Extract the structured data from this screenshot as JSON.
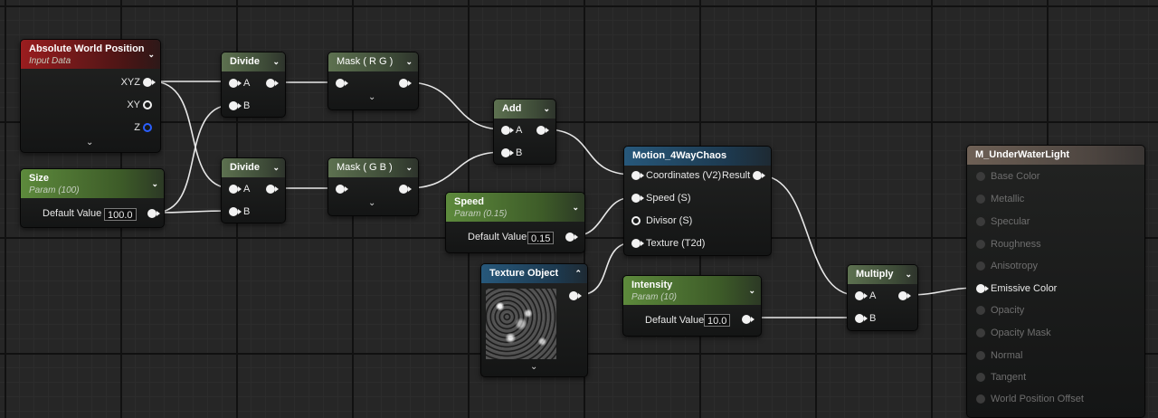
{
  "nodes": {
    "absolute_world_position": {
      "title": "Absolute World Position",
      "subtitle": "Input Data",
      "outputs": [
        "XYZ",
        "XY",
        "Z"
      ]
    },
    "size": {
      "title": "Size",
      "subtitle": "Param (100)",
      "default_label": "Default Value",
      "default_value": "100.0"
    },
    "divide_1": {
      "title": "Divide",
      "inputs": [
        "A",
        "B"
      ]
    },
    "divide_2": {
      "title": "Divide",
      "inputs": [
        "A",
        "B"
      ]
    },
    "mask_rg": {
      "title": "Mask ( R G )"
    },
    "mask_gb": {
      "title": "Mask ( G B )"
    },
    "add": {
      "title": "Add",
      "inputs": [
        "A",
        "B"
      ]
    },
    "speed": {
      "title": "Speed",
      "subtitle": "Param (0.15)",
      "default_label": "Default Value",
      "default_value": "0.15"
    },
    "texture_object": {
      "title": "Texture Object"
    },
    "motion_4waychaos": {
      "title": "Motion_4WayChaos",
      "inputs": [
        "Coordinates (V2)",
        "Speed (S)",
        "Divisor (S)",
        "Texture (T2d)"
      ],
      "output": "Result"
    },
    "intensity": {
      "title": "Intensity",
      "subtitle": "Param (10)",
      "default_label": "Default Value",
      "default_value": "10.0"
    },
    "multiply": {
      "title": "Multiply",
      "inputs": [
        "A",
        "B"
      ]
    },
    "material_result": {
      "title": "M_UnderWaterLight",
      "inputs": [
        "Base Color",
        "Metallic",
        "Specular",
        "Roughness",
        "Anisotropy",
        "Emissive Color",
        "Opacity",
        "Opacity Mask",
        "Normal",
        "Tangent",
        "World Position Offset"
      ],
      "active_input": "Emissive Color"
    }
  },
  "colors": {
    "wire": "#e8e8e8",
    "header_input_data": "#9a1d1f",
    "header_param": "#5d8a3c",
    "header_math": "#5d7150",
    "header_function": "#27587b",
    "header_result": "#6e6055",
    "pin_z": "#2b5fff"
  },
  "icons": [
    "chevron-down-icon",
    "chevron-up-icon",
    "expand-chevron-icon",
    "pin-connected-icon",
    "pin-unconnected-icon"
  ]
}
